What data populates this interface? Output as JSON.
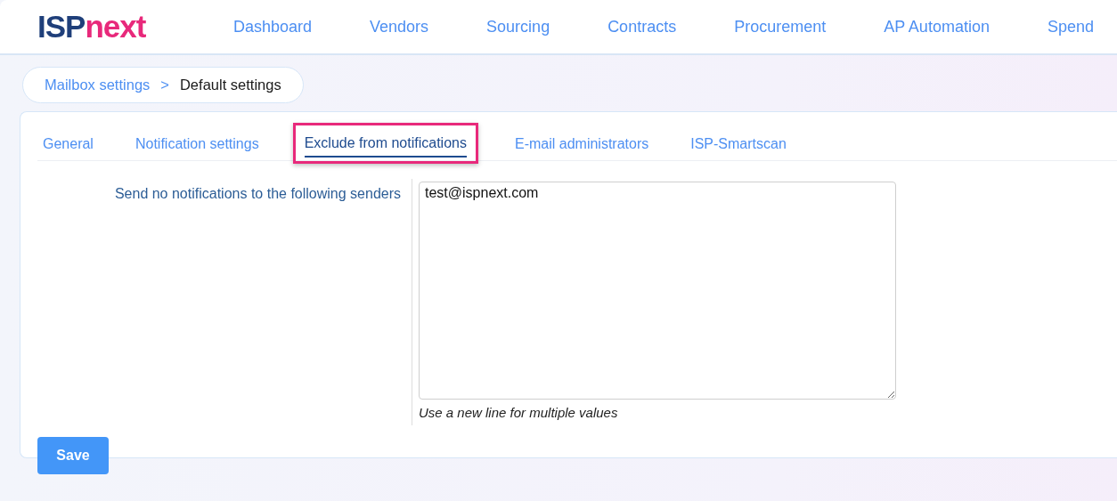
{
  "logo": {
    "part_1": "ISP",
    "part_2": "next"
  },
  "nav": [
    {
      "label": "Dashboard"
    },
    {
      "label": "Vendors"
    },
    {
      "label": "Sourcing"
    },
    {
      "label": "Contracts"
    },
    {
      "label": "Procurement"
    },
    {
      "label": "AP Automation"
    },
    {
      "label": "Spend"
    }
  ],
  "breadcrumb": {
    "link": "Mailbox settings",
    "separator": ">",
    "current": "Default settings"
  },
  "tabs": [
    {
      "label": "General",
      "selected": false,
      "highlighted": false
    },
    {
      "label": "Notification settings",
      "selected": false,
      "highlighted": false
    },
    {
      "label": "Exclude from notifications",
      "selected": true,
      "highlighted": true
    },
    {
      "label": "E-mail administrators",
      "selected": false,
      "highlighted": false
    },
    {
      "label": "ISP-Smartscan",
      "selected": false,
      "highlighted": false
    }
  ],
  "form": {
    "label": "Send no notifications to the following senders",
    "value": "test@ispnext.com",
    "hint": "Use a new line for multiple values"
  },
  "save_button": "Save"
}
